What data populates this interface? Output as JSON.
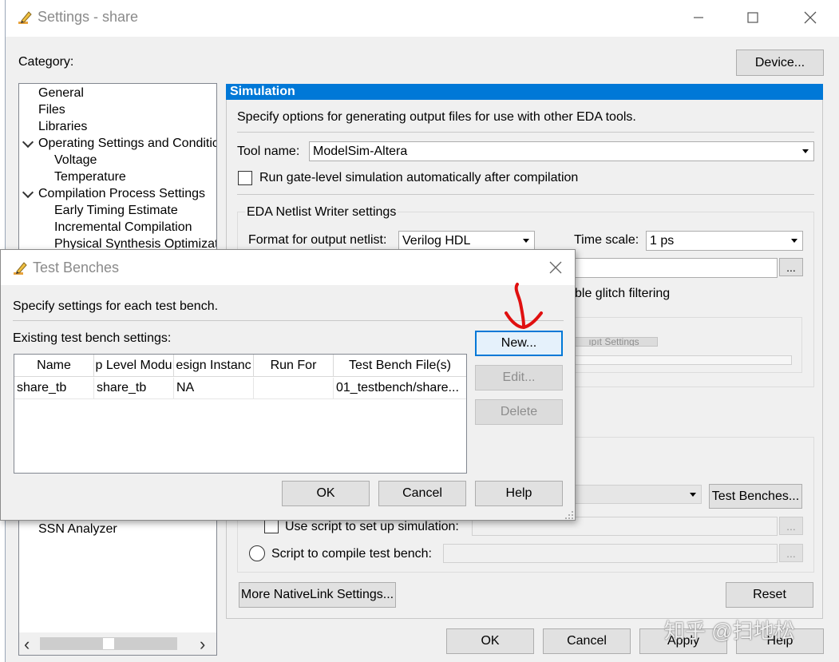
{
  "window": {
    "title": "Settings - share",
    "minimize": "—",
    "maximize": "☐",
    "close": "✕"
  },
  "category_label": "Category:",
  "device_button": "Device...",
  "tree": {
    "items": [
      {
        "label": "General",
        "level": 1
      },
      {
        "label": "Files",
        "level": 1
      },
      {
        "label": "Libraries",
        "level": 1
      },
      {
        "label": "Operating Settings and Conditic",
        "level": 0,
        "expanded": true
      },
      {
        "label": "Voltage",
        "level": 2
      },
      {
        "label": "Temperature",
        "level": 2
      },
      {
        "label": "Compilation Process Settings",
        "level": 0,
        "expanded": true
      },
      {
        "label": "Early Timing Estimate",
        "level": 2
      },
      {
        "label": "Incremental Compilation",
        "level": 2
      },
      {
        "label": "Physical Synthesis Optimizati",
        "level": 2
      },
      {
        "label": "SSN Analyzer",
        "level": 1
      }
    ],
    "scroll_left": "‹",
    "scroll_right": "›"
  },
  "simulation": {
    "header": "Simulation",
    "description": "Specify options for generating output files for use with other EDA tools.",
    "tool_name_label": "Tool name:",
    "tool_name_value": "ModelSim-Altera",
    "run_gate_level_label": "Run gate-level simulation automatically after compilation",
    "netlist_group_label": "EDA Netlist Writer settings",
    "format_label": "Format for output netlist:",
    "format_value": "Verilog HDL",
    "time_scale_label": "Time scale:",
    "time_scale_value": "1 ps",
    "ellipsis": "...",
    "glitch_text": "ble glitch filtering",
    "partial_button": "ıpıt Settings",
    "test_benches_button": "Test Benches...",
    "use_script_label": "Use script to set up simulation:",
    "compile_script_label": "Script to compile test bench:",
    "more_nativelink_button": "More NativeLink Settings...",
    "reset_button": "Reset"
  },
  "footer": {
    "ok": "OK",
    "cancel": "Cancel",
    "apply": "Apply",
    "help": "Help"
  },
  "dialog": {
    "title": "Test Benches",
    "close": "✕",
    "instructions": "Specify settings for each test bench.",
    "existing_label": "Existing test bench settings:",
    "columns": [
      "Name",
      "p Level Modu",
      "esign Instanc",
      "Run For",
      "Test Bench File(s)"
    ],
    "rows": [
      [
        "share_tb",
        "share_tb",
        "NA",
        "",
        "01_testbench/share..."
      ]
    ],
    "new_button": "New...",
    "edit_button": "Edit...",
    "delete_button": "Delete",
    "ok_button": "OK",
    "cancel_button": "Cancel",
    "help_button": "Help"
  },
  "annotation_color": "#e01010",
  "accent_color": "#0078d7",
  "watermark": "知乎 @扫地松"
}
